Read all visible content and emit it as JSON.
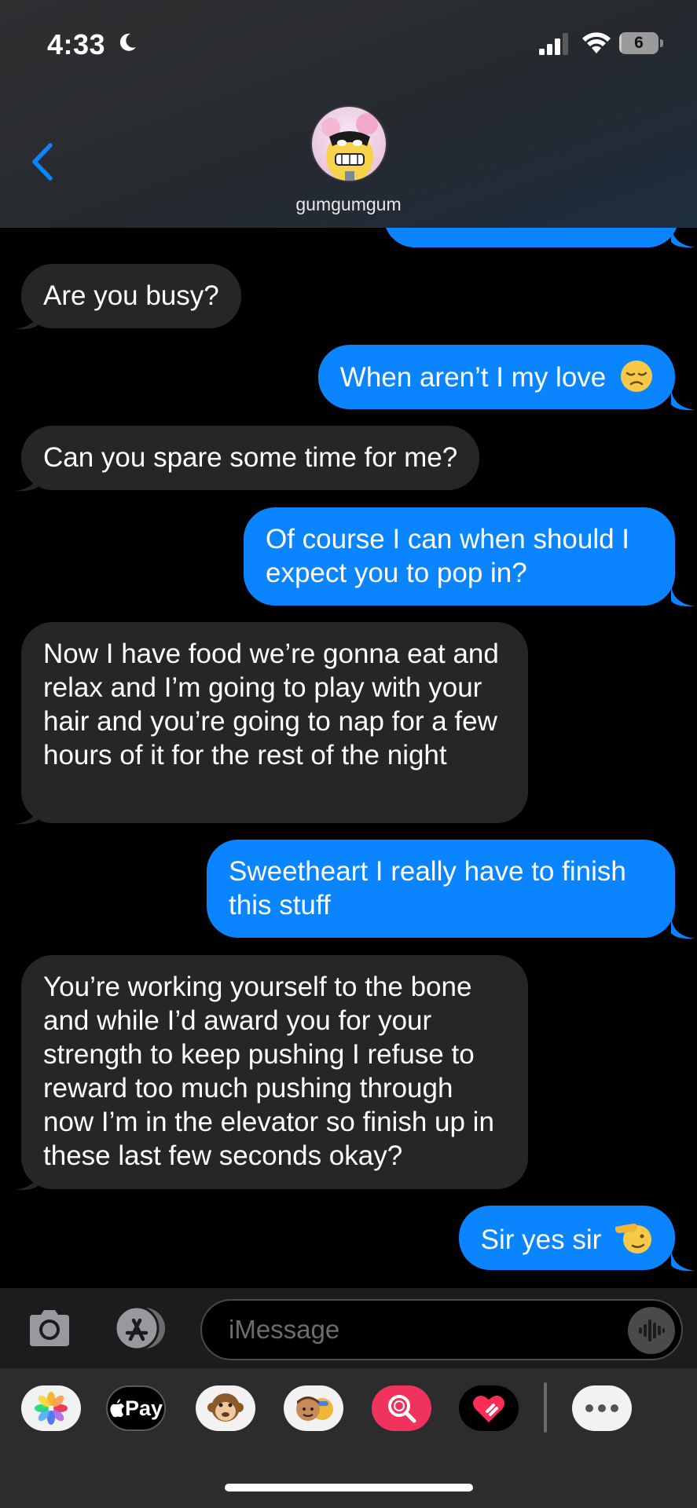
{
  "status_bar": {
    "time": "4:33",
    "battery_level": "6",
    "battery_fraction": 0.06
  },
  "header": {
    "contact_name": "gumgumgum"
  },
  "messages": [
    {
      "direction": "incoming",
      "text": "Are you busy?"
    },
    {
      "direction": "outgoing",
      "text": "When aren’t I my love",
      "emoji": "disappointed-face"
    },
    {
      "direction": "incoming",
      "text": "Can you spare some time for me?"
    },
    {
      "direction": "outgoing",
      "text": "Of course I can when should I expect you to pop in?"
    },
    {
      "direction": "incoming",
      "text": "Now I have food we’re gonna eat and relax and I’m going to play with your hair and you’re going to nap for a few hours of it for the rest of the night"
    },
    {
      "direction": "outgoing",
      "text": "Sweetheart I really have to finish this stuff"
    },
    {
      "direction": "incoming",
      "text": "You’re working yourself to the bone and while I’d award you for your strength to keep pushing I refuse to reward too much pushing through now I’m in the elevator so finish up in these last few seconds okay?"
    },
    {
      "direction": "outgoing",
      "text": "Sir yes sir",
      "emoji": "saluting-face"
    }
  ],
  "input": {
    "placeholder": "iMessage"
  },
  "app_drawer": {
    "apple_pay_label": "Pay",
    "items": [
      "photos-icon",
      "apple-pay-icon",
      "memoji-monkey-icon",
      "memoji-stickers-icon",
      "image-search-icon",
      "digital-touch-icon",
      "more-icon"
    ]
  },
  "colors": {
    "outgoing_bubble": "#0a84ff",
    "incoming_bubble": "#262628",
    "background": "#000000",
    "accent": "#0a84ff"
  }
}
